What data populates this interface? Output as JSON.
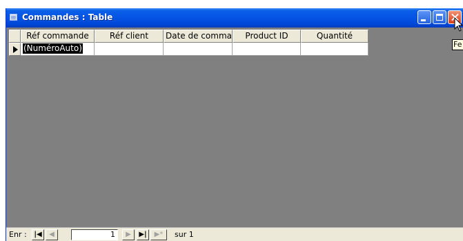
{
  "window": {
    "title": "Commandes : Table"
  },
  "table": {
    "columns": [
      "Réf commande",
      "Réf client",
      "Date de comma",
      "Product ID",
      "Quantité"
    ],
    "new_row": [
      "(NuméroAuto)",
      "",
      "",
      "",
      ""
    ]
  },
  "navigator": {
    "label": "Enr :",
    "current": "1",
    "total_text": "sur 1",
    "first_icon": "first-record-icon",
    "prev_icon": "prev-record-icon",
    "next_icon": "next-record-icon",
    "last_icon": "last-record-icon",
    "new_icon": "new-record-icon"
  },
  "tooltip": {
    "text": "Fe"
  },
  "colors": {
    "titlebar": "#0554e3",
    "close_button": "#d8411c",
    "workspace": "#808080"
  }
}
